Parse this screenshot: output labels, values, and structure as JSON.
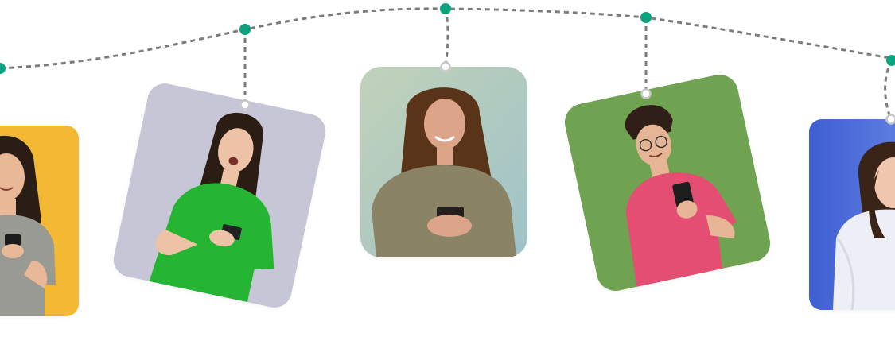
{
  "colors": {
    "pin": "#0aa37f",
    "string": "#7b7b7b",
    "hook": "#c9c9c9"
  },
  "cards": [
    {
      "name": "photo-card-yellow",
      "background": "#f3b935",
      "shirt": "#9a9a94",
      "hair": "#2a1d16",
      "skin": "#e8b897",
      "subject": "woman-smiling-at-phone"
    },
    {
      "name": "photo-card-lavender",
      "background": "#c7c6d6",
      "shirt": "#25b532",
      "hair": "#2b1c14",
      "skin": "#eec2a6",
      "subject": "woman-excited-with-phone"
    },
    {
      "name": "photo-card-sage",
      "background": "#b2c9b6",
      "shirt": "#8a8366",
      "hair": "#5a3418",
      "skin": "#dca58a",
      "subject": "woman-texting-on-phone"
    },
    {
      "name": "photo-card-green",
      "background": "#6fa352",
      "shirt": "#e34e72",
      "hair": "#2f1f18",
      "skin": "#e6b596",
      "subject": "man-with-glasses-reading-phone"
    },
    {
      "name": "photo-card-blue",
      "background": "#4f73d8",
      "shirt": "#eeeef6",
      "hair": "#3a2418",
      "skin": "#efc7ae",
      "subject": "woman-in-white-sweater"
    }
  ]
}
